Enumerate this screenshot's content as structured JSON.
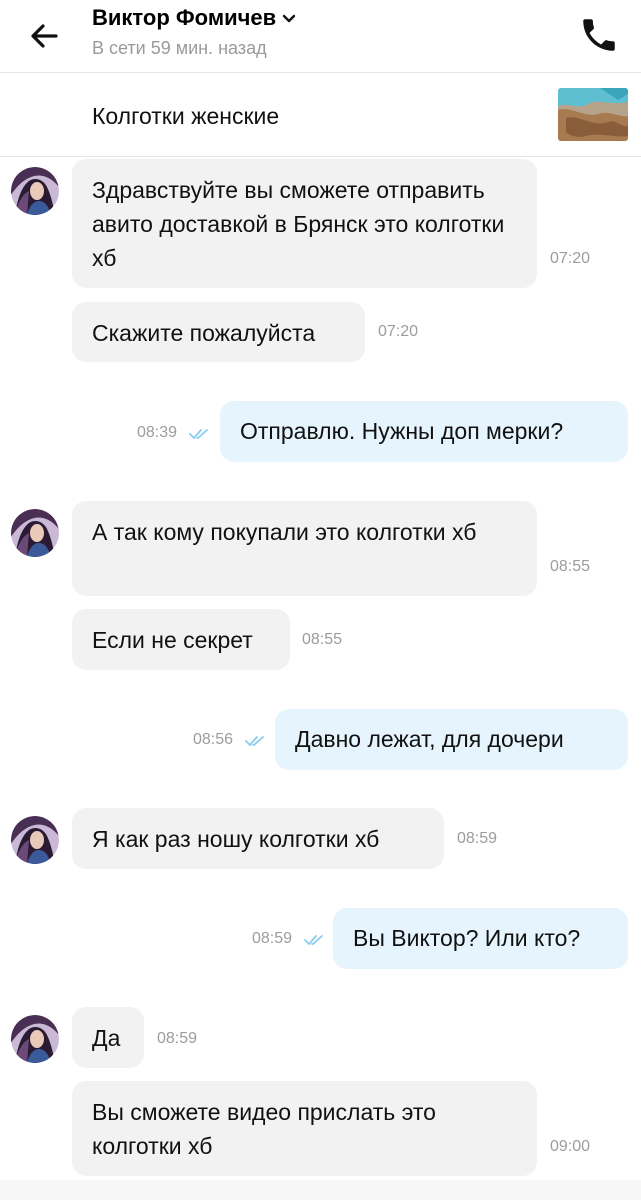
{
  "header": {
    "contact_name": "Виктор Фомичев",
    "status": "В сети 59 мин. назад"
  },
  "item": {
    "title": "Колготки женские"
  },
  "messages": [
    {
      "dir": "in",
      "text": "Здравствуйте вы сможете отправить авито доставкой в Брянск это колготки хб",
      "time": "07:20"
    },
    {
      "dir": "in",
      "text": "Скажите пожалуйста",
      "time": "07:20"
    },
    {
      "dir": "out",
      "text": "Отправлю. Нужны доп мерки?",
      "time": "08:39"
    },
    {
      "dir": "in",
      "text": "А так кому покупали это колготки хб",
      "time": "08:55"
    },
    {
      "dir": "in",
      "text": "Если не секрет",
      "time": "08:55"
    },
    {
      "dir": "out",
      "text": "Давно лежат,  для дочери",
      "time": "08:56"
    },
    {
      "dir": "in",
      "text": "Я как раз ношу колготки хб",
      "time": "08:59"
    },
    {
      "dir": "out",
      "text": "Вы Виктор? Или кто?",
      "time": "08:59"
    },
    {
      "dir": "in",
      "text": "Да",
      "time": "08:59"
    },
    {
      "dir": "in",
      "text": "Вы сможете видео прислать это колготки хб",
      "time": "09:00"
    }
  ],
  "colors": {
    "incoming_bubble": "#f2f2f2",
    "outgoing_bubble": "#e6f4fd",
    "read_check": "#8ccbf0"
  }
}
